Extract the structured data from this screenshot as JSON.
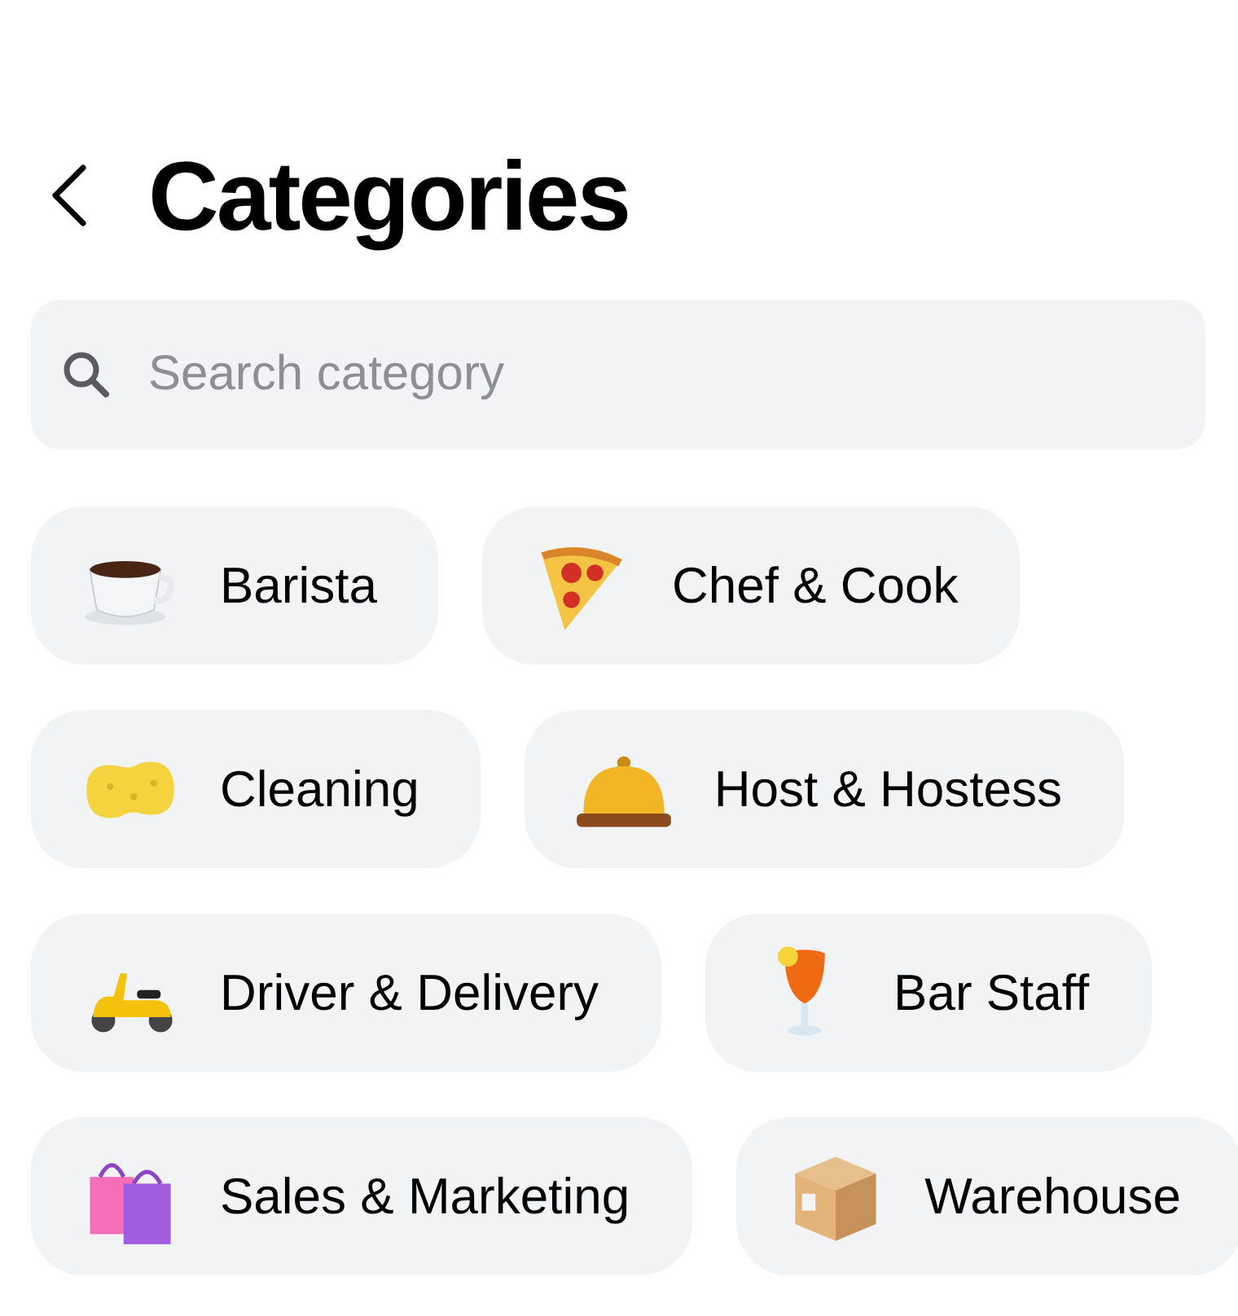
{
  "header": {
    "title": "Categories"
  },
  "search": {
    "placeholder": "Search category"
  },
  "category_rows": [
    [
      {
        "label": "Barista"
      },
      {
        "label": "Chef & Cook"
      }
    ],
    [
      {
        "label": "Cleaning"
      },
      {
        "label": "Host & Hostess"
      }
    ],
    [
      {
        "label": "Driver & Delivery"
      },
      {
        "label": "Bar Staff"
      }
    ],
    [
      {
        "label": "Sales & Marketing"
      },
      {
        "label": "Warehouse"
      }
    ]
  ]
}
